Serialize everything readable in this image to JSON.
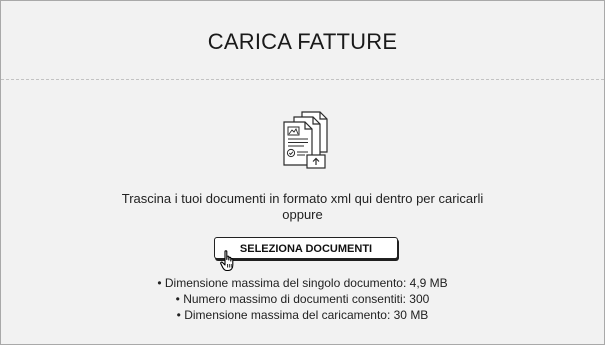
{
  "header": {
    "title": "CARICA FATTURE"
  },
  "dropzone": {
    "icon": "documents-upload-icon",
    "instruction_line1": "Trascina i tuoi documenti in formato xml qui dentro per caricarli",
    "instruction_line2": "oppure",
    "button_label": "SELEZIONA DOCUMENTI",
    "cursor": "hand-pointer-icon"
  },
  "limits": [
    "Dimensione massima del singolo documento: 4,9 MB",
    "Numero massimo di documenti consentiti: 300",
    "Dimensione massima del caricamento: 30 MB"
  ],
  "colors": {
    "panel_background": "#f2f2f2",
    "panel_border": "#a9a9a9",
    "divider": "#c3c3c3",
    "text": "#222222"
  }
}
